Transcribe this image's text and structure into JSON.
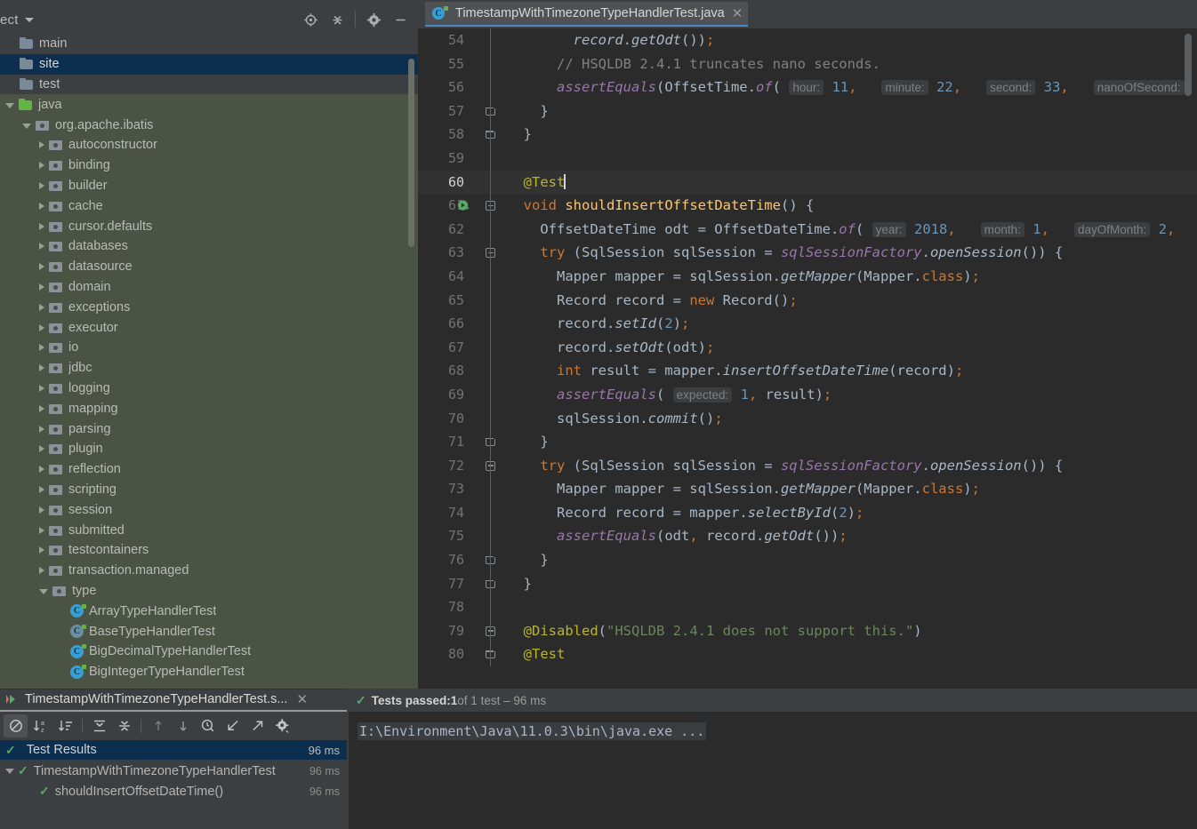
{
  "sidebar": {
    "title": "ect",
    "caret_icon": "chevron-down-icon",
    "tools": [
      {
        "name": "locate-icon",
        "label": "Select Opened File"
      },
      {
        "name": "collapse-all-icon",
        "label": "Collapse All"
      },
      {
        "name": "gear-icon",
        "label": "Options"
      },
      {
        "name": "minimize-icon",
        "label": "Hide"
      }
    ],
    "tree": [
      {
        "label": "main",
        "icon": "folder-icon",
        "indent": 0,
        "arrow": "none",
        "state": "dark"
      },
      {
        "label": "site",
        "icon": "folder-icon",
        "indent": 0,
        "arrow": "none",
        "state": "selected"
      },
      {
        "label": "test",
        "icon": "folder-icon",
        "indent": 0,
        "arrow": "none",
        "state": "dark"
      },
      {
        "label": "java",
        "icon": "source-folder-icon",
        "indent": 0,
        "arrow": "expanded",
        "state": "green"
      },
      {
        "label": "org.apache.ibatis",
        "icon": "package-icon",
        "indent": 1,
        "arrow": "expanded",
        "state": "green"
      },
      {
        "label": "autoconstructor",
        "icon": "package-icon",
        "indent": 2,
        "arrow": "collapsed",
        "state": "green"
      },
      {
        "label": "binding",
        "icon": "package-icon",
        "indent": 2,
        "arrow": "collapsed",
        "state": "green"
      },
      {
        "label": "builder",
        "icon": "package-icon",
        "indent": 2,
        "arrow": "collapsed",
        "state": "green"
      },
      {
        "label": "cache",
        "icon": "package-icon",
        "indent": 2,
        "arrow": "collapsed",
        "state": "green"
      },
      {
        "label": "cursor.defaults",
        "icon": "package-icon",
        "indent": 2,
        "arrow": "collapsed",
        "state": "green"
      },
      {
        "label": "databases",
        "icon": "package-icon",
        "indent": 2,
        "arrow": "collapsed",
        "state": "green"
      },
      {
        "label": "datasource",
        "icon": "package-icon",
        "indent": 2,
        "arrow": "collapsed",
        "state": "green"
      },
      {
        "label": "domain",
        "icon": "package-icon",
        "indent": 2,
        "arrow": "collapsed",
        "state": "green"
      },
      {
        "label": "exceptions",
        "icon": "package-icon",
        "indent": 2,
        "arrow": "collapsed",
        "state": "green"
      },
      {
        "label": "executor",
        "icon": "package-icon",
        "indent": 2,
        "arrow": "collapsed",
        "state": "green"
      },
      {
        "label": "io",
        "icon": "package-icon",
        "indent": 2,
        "arrow": "collapsed",
        "state": "green"
      },
      {
        "label": "jdbc",
        "icon": "package-icon",
        "indent": 2,
        "arrow": "collapsed",
        "state": "green"
      },
      {
        "label": "logging",
        "icon": "package-icon",
        "indent": 2,
        "arrow": "collapsed",
        "state": "green"
      },
      {
        "label": "mapping",
        "icon": "package-icon",
        "indent": 2,
        "arrow": "collapsed",
        "state": "green"
      },
      {
        "label": "parsing",
        "icon": "package-icon",
        "indent": 2,
        "arrow": "collapsed",
        "state": "green"
      },
      {
        "label": "plugin",
        "icon": "package-icon",
        "indent": 2,
        "arrow": "collapsed",
        "state": "green"
      },
      {
        "label": "reflection",
        "icon": "package-icon",
        "indent": 2,
        "arrow": "collapsed",
        "state": "green"
      },
      {
        "label": "scripting",
        "icon": "package-icon",
        "indent": 2,
        "arrow": "collapsed",
        "state": "green"
      },
      {
        "label": "session",
        "icon": "package-icon",
        "indent": 2,
        "arrow": "collapsed",
        "state": "green"
      },
      {
        "label": "submitted",
        "icon": "package-icon",
        "indent": 2,
        "arrow": "collapsed",
        "state": "green"
      },
      {
        "label": "testcontainers",
        "icon": "package-icon",
        "indent": 2,
        "arrow": "collapsed",
        "state": "green"
      },
      {
        "label": "transaction.managed",
        "icon": "package-icon",
        "indent": 2,
        "arrow": "collapsed",
        "state": "green"
      },
      {
        "label": "type",
        "icon": "package-icon",
        "indent": 2,
        "arrow": "expanded",
        "state": "green"
      },
      {
        "label": "ArrayTypeHandlerTest",
        "icon": "java-class-icon",
        "indent": 3,
        "arrow": "none",
        "state": "green"
      },
      {
        "label": "BaseTypeHandlerTest",
        "icon": "java-abstract-class-icon",
        "indent": 3,
        "arrow": "none",
        "state": "green"
      },
      {
        "label": "BigDecimalTypeHandlerTest",
        "icon": "java-class-icon",
        "indent": 3,
        "arrow": "none",
        "state": "green"
      },
      {
        "label": "BigIntegerTypeHandlerTest",
        "icon": "java-class-icon",
        "indent": 3,
        "arrow": "none",
        "state": "green"
      }
    ]
  },
  "editor": {
    "tab": {
      "label": "TimestampWithTimezoneTypeHandlerTest.java",
      "icon": "java-test-class-icon",
      "close_icon": "close-icon"
    },
    "lines": [
      {
        "n": "54",
        "fold": "",
        "run": false,
        "current": false,
        "indent": 0,
        "html": "        <span class=\"mth\">record</span><span class=\"pun\">.</span><span class=\"mth\">getOdt</span><span class=\"pun\">())</span><span class=\"semi\">;</span>"
      },
      {
        "n": "55",
        "fold": "",
        "run": false,
        "current": false,
        "indent": 0,
        "html": "      <span class=\"cmt\">// HSQLDB 2.4.1 truncates nano seconds.</span>"
      },
      {
        "n": "56",
        "fold": "",
        "run": false,
        "current": false,
        "indent": 0,
        "html": "      <span class=\"stat\">assertEquals</span><span class=\"pun\">(OffsetTime.</span><span class=\"stat\">of</span><span class=\"pun\">(</span> <span class=\"hint\">hour:</span> <span class=\"num\">11</span><span class=\"semi\">,</span>   <span class=\"hint\">minute:</span> <span class=\"num\">22</span><span class=\"semi\">,</span>   <span class=\"hint\">second:</span> <span class=\"num\">33</span><span class=\"semi\">,</span>   <span class=\"hint\">nanoOfSecond:</span>"
      },
      {
        "n": "57",
        "fold": "end",
        "run": false,
        "current": false,
        "indent": 0,
        "html": "    <span class=\"pun\">}</span>"
      },
      {
        "n": "58",
        "fold": "end",
        "run": false,
        "current": false,
        "indent": 0,
        "html": "  <span class=\"pun\">}</span>"
      },
      {
        "n": "59",
        "fold": "",
        "run": false,
        "current": false,
        "indent": 0,
        "html": ""
      },
      {
        "n": "60",
        "fold": "",
        "run": false,
        "current": true,
        "indent": 0,
        "html": "  <span class=\"ann\">@Test</span><span class=\"caret\"></span>"
      },
      {
        "n": "61",
        "fold": "minus",
        "run": true,
        "current": false,
        "indent": 0,
        "html": "  <span class=\"kw\">void</span> <span class=\"fn\">shouldInsertOffsetDateTime</span><span class=\"pun\">() {</span>"
      },
      {
        "n": "62",
        "fold": "",
        "run": false,
        "current": false,
        "indent": 0,
        "html": "    <span class=\"pun\">OffsetDateTime odt = OffsetDateTime.</span><span class=\"stat\">of</span><span class=\"pun\">(</span> <span class=\"hint\">year:</span> <span class=\"num\">2018</span><span class=\"semi\">,</span>   <span class=\"hint\">month:</span> <span class=\"num\">1</span><span class=\"semi\">,</span>   <span class=\"hint\">dayOfMonth:</span> <span class=\"num\">2</span><span class=\"semi\">,</span>"
      },
      {
        "n": "63",
        "fold": "minus",
        "run": false,
        "current": false,
        "indent": 0,
        "html": "    <span class=\"kw\">try</span> <span class=\"pun\">(SqlSession sqlSession = </span><span class=\"stat\">sqlSessionFactory</span><span class=\"pun\">.</span><span class=\"mth\">openSession</span><span class=\"pun\">()) {</span>"
      },
      {
        "n": "64",
        "fold": "",
        "run": false,
        "current": false,
        "indent": 0,
        "html": "      <span class=\"pun\">Mapper mapper = sqlSession.</span><span class=\"mth\">getMapper</span><span class=\"pun\">(Mapper.</span><span class=\"kw\">class</span><span class=\"pun\">)</span><span class=\"semi\">;</span>"
      },
      {
        "n": "65",
        "fold": "",
        "run": false,
        "current": false,
        "indent": 0,
        "html": "      <span class=\"pun\">Record record = </span><span class=\"kw\">new</span><span class=\"pun\"> Record()</span><span class=\"semi\">;</span>"
      },
      {
        "n": "66",
        "fold": "",
        "run": false,
        "current": false,
        "indent": 0,
        "html": "      <span class=\"pun\">record.</span><span class=\"mth\">setId</span><span class=\"pun\">(</span><span class=\"num\">2</span><span class=\"pun\">)</span><span class=\"semi\">;</span>"
      },
      {
        "n": "67",
        "fold": "",
        "run": false,
        "current": false,
        "indent": 0,
        "html": "      <span class=\"pun\">record.</span><span class=\"mth\">setOdt</span><span class=\"pun\">(odt)</span><span class=\"semi\">;</span>"
      },
      {
        "n": "68",
        "fold": "",
        "run": false,
        "current": false,
        "indent": 0,
        "html": "      <span class=\"kw\">int</span><span class=\"pun\"> result = mapper.</span><span class=\"mth\">insertOffsetDateTime</span><span class=\"pun\">(record)</span><span class=\"semi\">;</span>"
      },
      {
        "n": "69",
        "fold": "",
        "run": false,
        "current": false,
        "indent": 0,
        "html": "      <span class=\"stat\">assertEquals</span><span class=\"pun\">(</span> <span class=\"hint\">expected:</span> <span class=\"num\">1</span><span class=\"semi\">,</span><span class=\"pun\"> result)</span><span class=\"semi\">;</span>"
      },
      {
        "n": "70",
        "fold": "",
        "run": false,
        "current": false,
        "indent": 0,
        "html": "      <span class=\"pun\">sqlSession.</span><span class=\"mth\">commit</span><span class=\"pun\">()</span><span class=\"semi\">;</span>"
      },
      {
        "n": "71",
        "fold": "end",
        "run": false,
        "current": false,
        "indent": 0,
        "html": "    <span class=\"pun\">}</span>"
      },
      {
        "n": "72",
        "fold": "minus",
        "run": false,
        "current": false,
        "indent": 0,
        "html": "    <span class=\"kw\">try</span> <span class=\"pun\">(SqlSession sqlSession = </span><span class=\"stat\">sqlSessionFactory</span><span class=\"pun\">.</span><span class=\"mth\">openSession</span><span class=\"pun\">()) {</span>"
      },
      {
        "n": "73",
        "fold": "",
        "run": false,
        "current": false,
        "indent": 0,
        "html": "      <span class=\"pun\">Mapper mapper = sqlSession.</span><span class=\"mth\">getMapper</span><span class=\"pun\">(Mapper.</span><span class=\"kw\">class</span><span class=\"pun\">)</span><span class=\"semi\">;</span>"
      },
      {
        "n": "74",
        "fold": "",
        "run": false,
        "current": false,
        "indent": 0,
        "html": "      <span class=\"pun\">Record record = mapper.</span><span class=\"mth\">selectById</span><span class=\"pun\">(</span><span class=\"num\">2</span><span class=\"pun\">)</span><span class=\"semi\">;</span>"
      },
      {
        "n": "75",
        "fold": "",
        "run": false,
        "current": false,
        "indent": 0,
        "html": "      <span class=\"stat\">assertEquals</span><span class=\"pun\">(odt</span><span class=\"semi\">,</span><span class=\"pun\"> record.</span><span class=\"mth\">getOdt</span><span class=\"pun\">())</span><span class=\"semi\">;</span>"
      },
      {
        "n": "76",
        "fold": "end",
        "run": false,
        "current": false,
        "indent": 0,
        "html": "    <span class=\"pun\">}</span>"
      },
      {
        "n": "77",
        "fold": "end",
        "run": false,
        "current": false,
        "indent": 0,
        "html": "  <span class=\"pun\">}</span>"
      },
      {
        "n": "78",
        "fold": "",
        "run": false,
        "current": false,
        "indent": 0,
        "html": ""
      },
      {
        "n": "79",
        "fold": "minus",
        "run": false,
        "current": false,
        "indent": 0,
        "html": "  <span class=\"ann\">@Disabled</span><span class=\"pun\">(</span><span class=\"str\">\"HSQLDB 2.4.1 does not support this.\"</span><span class=\"pun\">)</span>"
      },
      {
        "n": "80",
        "fold": "end",
        "run": false,
        "current": false,
        "indent": 0,
        "html": "  <span class=\"ann\">@Test</span>"
      }
    ],
    "code_text": [
      "        record.getOdt());",
      "      // HSQLDB 2.4.1 truncates nano seconds.",
      "      assertEquals(OffsetTime.of( hour: 11, minute: 22, second: 33, nanoOfSecond:",
      "    }",
      "  }",
      "",
      "  @Test",
      "  void shouldInsertOffsetDateTime() {",
      "    OffsetDateTime odt = OffsetDateTime.of( year: 2018, month: 1, dayOfMonth: 2,",
      "    try (SqlSession sqlSession = sqlSessionFactory.openSession()) {",
      "      Mapper mapper = sqlSession.getMapper(Mapper.class);",
      "      Record record = new Record();",
      "      record.setId(2);",
      "      record.setOdt(odt);",
      "      int result = mapper.insertOffsetDateTime(record);",
      "      assertEquals( expected: 1, result);",
      "      sqlSession.commit();",
      "    }",
      "    try (SqlSession sqlSession = sqlSessionFactory.openSession()) {",
      "      Mapper mapper = sqlSession.getMapper(Mapper.class);",
      "      Record record = mapper.selectById(2);",
      "      assertEquals(odt, record.getOdt());",
      "    }",
      "  }",
      "",
      "  @Disabled(\"HSQLDB 2.4.1 does not support this.\")",
      "  @Test"
    ]
  },
  "bottom_panel": {
    "tab": {
      "label": "TimestampWithTimezoneTypeHandlerTest.s...",
      "run_icon": "run-configuration-icon",
      "close_icon": "close-icon"
    },
    "toolbar": [
      {
        "name": "hide-passed-icon",
        "label": "Hide Passed",
        "active": true
      },
      {
        "name": "sort-alphabetically-icon",
        "label": "Sort Alphabetically",
        "active": false
      },
      {
        "name": "sort-by-duration-icon",
        "label": "Sort by Duration",
        "active": false
      },
      {
        "name": "expand-all-icon",
        "label": "Expand All",
        "active": false
      },
      {
        "name": "collapse-all-icon",
        "label": "Collapse All",
        "active": false
      },
      {
        "name": "prev-failed-icon",
        "label": "Previous Failed Test",
        "active": false
      },
      {
        "name": "next-failed-icon",
        "label": "Next Failed Test",
        "active": false
      },
      {
        "name": "test-history-icon",
        "label": "Test History",
        "active": false
      },
      {
        "name": "import-tests-icon",
        "label": "Import Tests",
        "active": false
      },
      {
        "name": "export-tests-icon",
        "label": "Export Tests",
        "active": false
      },
      {
        "name": "gear-icon",
        "label": "Settings",
        "active": false
      }
    ],
    "results_header": {
      "label": "Test Results",
      "duration": "96 ms",
      "status_icon": "check-icon"
    },
    "rows": [
      {
        "label": "TimestampWithTimezoneTypeHandlerTest",
        "duration": "96 ms",
        "indent": 0,
        "arrow": "expanded",
        "status_icon": "check-icon"
      },
      {
        "label": "shouldInsertOffsetDateTime()",
        "duration": "96 ms",
        "indent": 1,
        "arrow": "none",
        "status_icon": "check-icon"
      }
    ],
    "console": {
      "status_prefix": "Tests passed: ",
      "status_count": "1",
      "status_suffix": " of 1 test – 96 ms",
      "status_icon": "check-icon",
      "output": "I:\\Environment\\Java\\11.0.3\\bin\\java.exe ..."
    }
  },
  "colors": {
    "editor_bg": "#2b2b2b",
    "panel_bg": "#3c3f41",
    "tree_scope_green": "#4b5345",
    "selection_blue": "#0d2f4f",
    "tab_underline": "#4a88c7",
    "success_green": "#59a869",
    "keyword_orange": "#cc7832",
    "annotation_yellow": "#bbb529",
    "string_green": "#6a8759",
    "number_blue": "#6897bb",
    "method_yellow": "#ffc66d",
    "static_purple": "#9876aa"
  }
}
